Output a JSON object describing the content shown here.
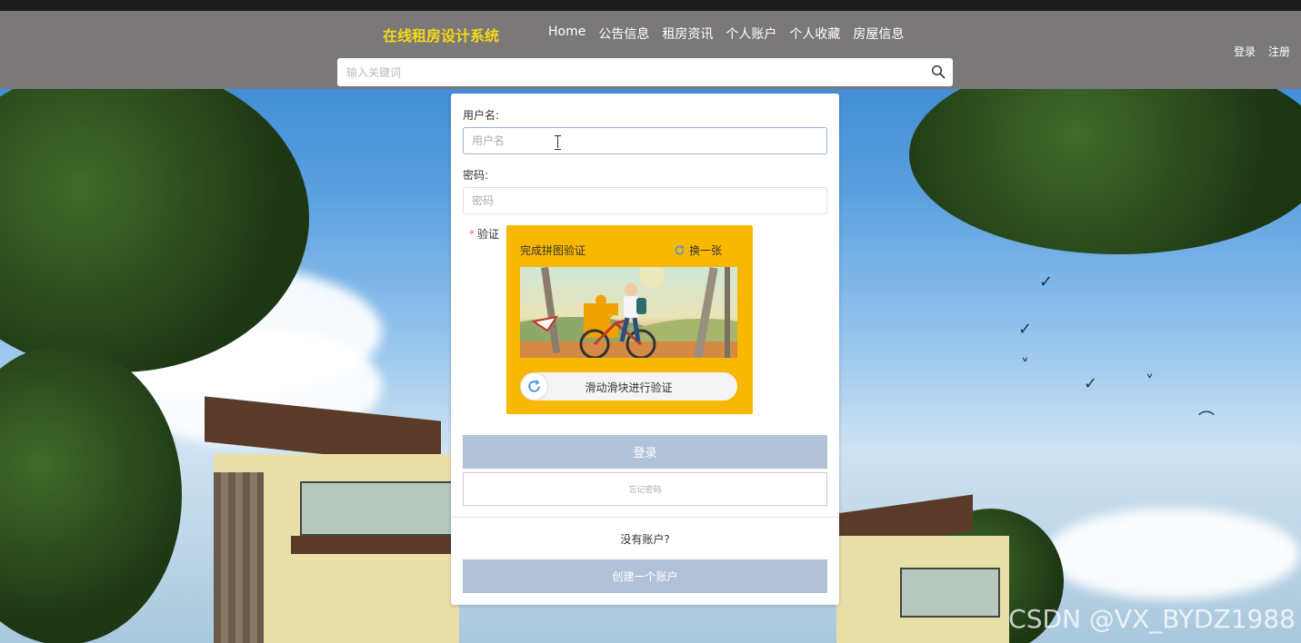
{
  "header": {
    "logo": "在线租房设计系统",
    "nav": [
      "Home",
      "公告信息",
      "租房资讯",
      "个人账户",
      "个人收藏",
      "房屋信息"
    ],
    "login_link": "登录",
    "register_link": "注册",
    "search_placeholder": "输入关键词"
  },
  "form": {
    "username_label": "用户名:",
    "username_placeholder": "用户名",
    "password_label": "密码:",
    "password_placeholder": "密码",
    "verify_label": "验证",
    "captcha_title": "完成拼图验证",
    "captcha_refresh": "换一张",
    "slider_text": "滑动滑块进行验证",
    "login_button": "登录",
    "forgot_button": "忘记密码",
    "no_account": "没有账户?",
    "create_button": "创建一个账户"
  },
  "colors": {
    "header_bg": "#7a7879",
    "logo": "#f6d915",
    "captcha_bg": "#f9b800",
    "button_bg": "#b1c1d7"
  },
  "watermark": "CSDN @VX_BYDZ1988"
}
